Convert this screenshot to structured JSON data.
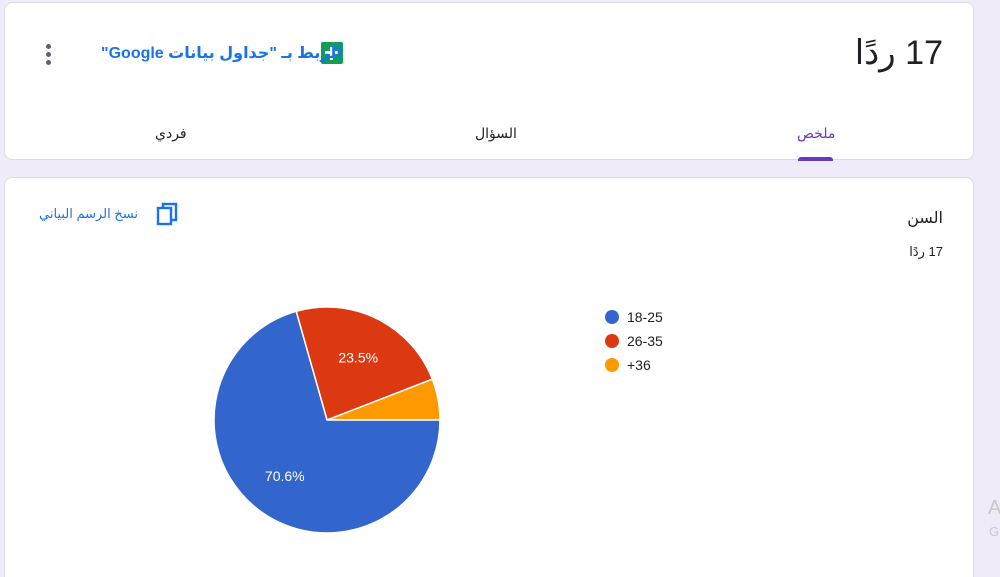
{
  "header": {
    "response_count": "17 ردًا",
    "sheets_link_label": "الربط بـ \"جداول بيانات Google\"",
    "tabs": [
      {
        "label": "ملخص",
        "active": true
      },
      {
        "label": "السؤال",
        "active": false
      },
      {
        "label": "فردي",
        "active": false
      }
    ]
  },
  "question": {
    "title": "السن",
    "response_count": "17 ردًا",
    "copy_chart_label": "نسخ الرسم البياني"
  },
  "chart_data": {
    "type": "pie",
    "categories": [
      "18-25",
      "26-35",
      "+36"
    ],
    "values": [
      70.6,
      23.5,
      5.9
    ],
    "data_labels": [
      "70.6%",
      "23.5%",
      ""
    ],
    "colors": [
      "#3366cc",
      "#dc3912",
      "#ff9900"
    ],
    "legend_position": "right"
  },
  "side_text": {
    "line1": "A",
    "line2": "G"
  },
  "colors": {
    "accent": "#673ab7",
    "link": "#1a73e8",
    "sheets_green": "#0f9d58"
  }
}
